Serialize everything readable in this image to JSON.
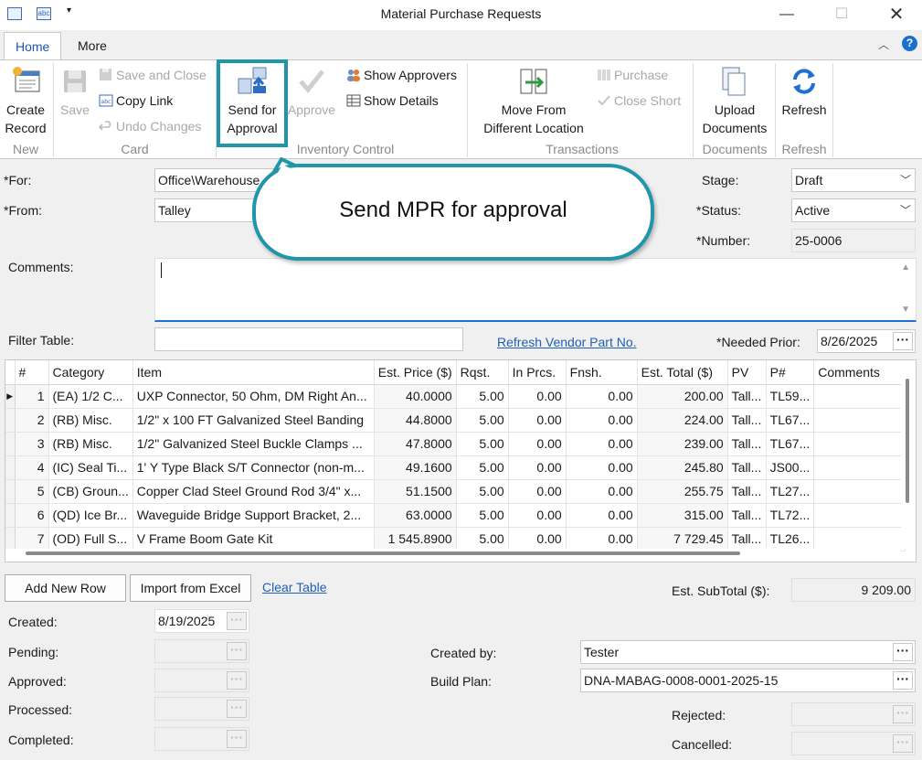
{
  "window": {
    "title": "Material Purchase Requests"
  },
  "tabs": {
    "home": "Home",
    "more": "More"
  },
  "ribbon": {
    "create_record": "Create Record",
    "save": "Save",
    "save_and_close": "Save and Close",
    "copy_link": "Copy Link",
    "undo_changes": "Undo Changes",
    "send_for_approval": "Send for Approval",
    "approve": "Approve",
    "show_approvers": "Show Approvers",
    "show_details": "Show Details",
    "move_from": "Move From Different Location",
    "purchase": "Purchase",
    "close_short": "Close Short",
    "upload_documents": "Upload Documents",
    "refresh": "Refresh",
    "groups": {
      "new": "New",
      "card": "Card",
      "inventory_control": "Inventory Control",
      "transactions": "Transactions",
      "documents": "Documents",
      "refresh": "Refresh"
    }
  },
  "form": {
    "for_label": "*For:",
    "for_value": "Office\\Warehouse",
    "from_label": "*From:",
    "from_value": "Talley",
    "stage_label": "Stage:",
    "stage_value": "Draft",
    "status_label": "*Status:",
    "status_value": "Active",
    "number_label": "*Number:",
    "number_value": "25-0006",
    "comments_label": "Comments:",
    "filter_label": "Filter Table:",
    "refresh_vendor": "Refresh Vendor Part No.",
    "needed_label": "*Needed Prior:",
    "needed_value": "8/26/2025"
  },
  "callout": {
    "text": "Send MPR for approval"
  },
  "grid": {
    "columns": [
      "#",
      "Category",
      "Item",
      "Est. Price ($)",
      "Rqst.",
      "In Prcs.",
      "Fnsh.",
      "Est. Total ($)",
      "PV",
      "P#",
      "Comments"
    ],
    "rows": [
      {
        "n": "1",
        "cat": "(EA) 1/2 C...",
        "item": "UXP Connector, 50 Ohm, DM Right An...",
        "price": "40.0000",
        "rqst": "5.00",
        "inprcs": "0.00",
        "fnsh": "0.00",
        "total": "200.00",
        "pv": "Tall...",
        "p": "TL59...",
        "comments": ""
      },
      {
        "n": "2",
        "cat": "(RB) Misc.",
        "item": "1/2\" x 100 FT Galvanized Steel Banding",
        "price": "44.8000",
        "rqst": "5.00",
        "inprcs": "0.00",
        "fnsh": "0.00",
        "total": "224.00",
        "pv": "Tall...",
        "p": "TL67...",
        "comments": ""
      },
      {
        "n": "3",
        "cat": "(RB) Misc.",
        "item": "1/2\" Galvanized Steel Buckle Clamps ...",
        "price": "47.8000",
        "rqst": "5.00",
        "inprcs": "0.00",
        "fnsh": "0.00",
        "total": "239.00",
        "pv": "Tall...",
        "p": "TL67...",
        "comments": ""
      },
      {
        "n": "4",
        "cat": "(IC) Seal Ti...",
        "item": "1' Y Type Black S/T Connector (non-m...",
        "price": "49.1600",
        "rqst": "5.00",
        "inprcs": "0.00",
        "fnsh": "0.00",
        "total": "245.80",
        "pv": "Tall...",
        "p": "JS00...",
        "comments": ""
      },
      {
        "n": "5",
        "cat": "(CB) Groun...",
        "item": "Copper Clad Steel Ground Rod 3/4\" x...",
        "price": "51.1500",
        "rqst": "5.00",
        "inprcs": "0.00",
        "fnsh": "0.00",
        "total": "255.75",
        "pv": "Tall...",
        "p": "TL27...",
        "comments": ""
      },
      {
        "n": "6",
        "cat": "(QD) Ice Br...",
        "item": "Waveguide Bridge Support Bracket, 2...",
        "price": "63.0000",
        "rqst": "5.00",
        "inprcs": "0.00",
        "fnsh": "0.00",
        "total": "315.00",
        "pv": "Tall...",
        "p": "TL72...",
        "comments": ""
      },
      {
        "n": "7",
        "cat": "(OD) Full S...",
        "item": "V Frame Boom Gate Kit",
        "price": "1 545.8900",
        "rqst": "5.00",
        "inprcs": "0.00",
        "fnsh": "0.00",
        "total": "7 729.45",
        "pv": "Tall...",
        "p": "TL26...",
        "comments": ""
      }
    ]
  },
  "bottom": {
    "add_new_row": "Add New Row",
    "import_excel": "Import from Excel",
    "clear_table": "Clear Table",
    "subtotal_label": "Est. SubTotal ($):",
    "subtotal_value": "9 209.00",
    "created_label": "Created:",
    "created_value": "8/19/2025",
    "pending_label": "Pending:",
    "approved_label": "Approved:",
    "processed_label": "Processed:",
    "completed_label": "Completed:",
    "created_by_label": "Created by:",
    "created_by_value": "Tester",
    "build_plan_label": "Build Plan:",
    "build_plan_value": "DNA-MABAG-0008-0001-2025-15",
    "rejected_label": "Rejected:",
    "cancelled_label": "Cancelled:"
  },
  "colors": {
    "accent": "#2196a9",
    "link": "#1f5fb6",
    "tab_active": "#1a56a8"
  }
}
